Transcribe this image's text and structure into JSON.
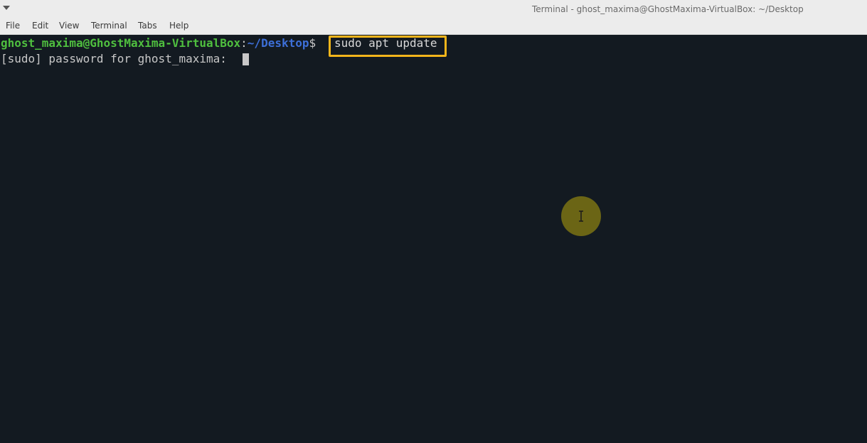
{
  "window": {
    "title": "Terminal - ghost_maxima@GhostMaxima-VirtualBox: ~/Desktop"
  },
  "menubar": {
    "items": [
      "File",
      "Edit",
      "View",
      "Terminal",
      "Tabs",
      "Help"
    ]
  },
  "terminal": {
    "prompt_user_host": "ghost_maxima@GhostMaxima-VirtualBox",
    "prompt_colon": ":",
    "prompt_path": "~/Desktop",
    "prompt_symbol": "$",
    "command": "sudo apt update",
    "sudo_prompt": "[sudo] password for ghost_maxima: "
  },
  "colors": {
    "background": "#131a21",
    "prompt_user": "#4fbf3f",
    "prompt_path": "#3d6fd8",
    "highlight_border": "#f2b51b",
    "mouse_indicator": "#6b6515"
  },
  "icons": {
    "window_menu": "triangle-down-icon",
    "text_cursor": "i-beam-cursor-icon"
  }
}
